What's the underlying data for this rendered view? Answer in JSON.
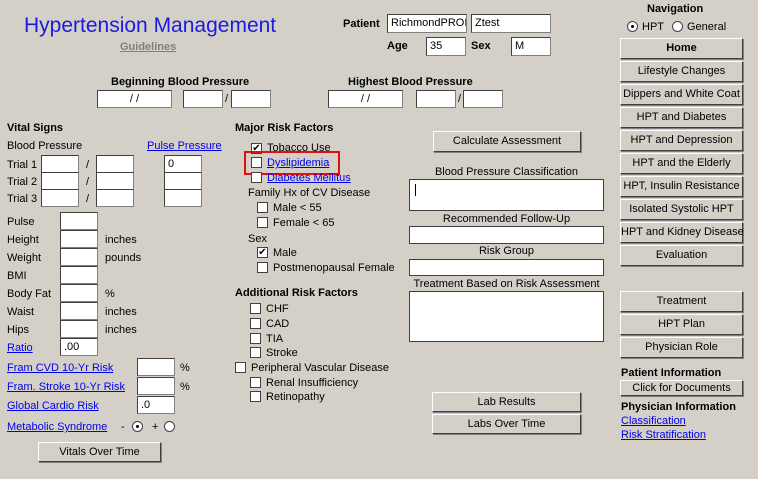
{
  "app": {
    "title": "Hypertension Management",
    "guidelines_link": "Guidelines"
  },
  "patient": {
    "label": "Patient",
    "first_name": "RichmondPROI",
    "last_name": "Ztest",
    "age_label": "Age",
    "age": "35",
    "sex_label": "Sex",
    "sex": "M"
  },
  "bp": {
    "beginning_label": "Beginning Blood Pressure",
    "beginning_date": "/ /",
    "highest_label": "Highest Blood Pressure",
    "highest_date": "/ /",
    "slash": "/"
  },
  "vitals": {
    "heading": "Vital Signs",
    "bp_label": "Blood Pressure",
    "pulse_pressure_link": "Pulse Pressure",
    "trials": [
      "Trial 1",
      "Trial 2",
      "Trial 3"
    ],
    "pulse_pressure_value": "0",
    "pulse": "Pulse",
    "height": "Height",
    "weight": "Weight",
    "bmi": "BMI",
    "body_fat": "Body Fat",
    "waist": "Waist",
    "hips": "Hips",
    "inches": "inches",
    "pounds": "pounds",
    "percent": "%",
    "ratio_link": "Ratio",
    "ratio_value": ".00",
    "fram_cvd_link": "Fram CVD 10-Yr Risk",
    "fram_stroke_link": "Fram. Stroke 10-Yr Risk",
    "global_cardio_link": "Global Cardio Risk",
    "global_cardio_value": ".0",
    "metabolic_link": "Metabolic Syndrome",
    "minus": "-",
    "plus": "+",
    "vitals_over_time": "Vitals Over Time"
  },
  "risk": {
    "heading": "Major Risk Factors",
    "tobacco": "Tobacco Use",
    "dyslipidemia": "Dyslipidemia",
    "diabetes": "Diabetes Mellitus",
    "family_hx": "Family Hx of CV Disease",
    "male_55": "Male < 55",
    "female_65": "Female < 65",
    "sex_label": "Sex",
    "male": "Male",
    "postmenopausal": "Postmenopausal Female",
    "additional_heading": "Additional Risk Factors",
    "chf": "CHF",
    "cad": "CAD",
    "tia": "TIA",
    "stroke": "Stroke",
    "pvd": "Peripheral Vascular Disease",
    "renal": "Renal Insufficiency",
    "retinopathy": "Retinopathy"
  },
  "assessment": {
    "calculate": "Calculate Assessment",
    "classification": "Blood Pressure Classification",
    "follow_up": "Recommended Follow-Up",
    "risk_group": "Risk Group",
    "treatment": "Treatment Based on Risk Assessment",
    "lab_results": "Lab Results",
    "labs_over_time": "Labs Over Time"
  },
  "navigation": {
    "heading": "Navigation",
    "hpt": "HPT",
    "general": "General",
    "items": [
      "Home",
      "Lifestyle Changes",
      "Dippers and White Coat",
      "HPT and Diabetes",
      "HPT and Depression",
      "HPT and the Elderly",
      "HPT,  Insulin Resistance",
      "Isolated Systolic HPT",
      "HPT and Kidney Disease",
      "Evaluation"
    ],
    "items2": [
      "Treatment",
      "HPT Plan",
      "Physician Role"
    ],
    "patient_info_heading": "Patient Information",
    "click_docs": "Click for Documents",
    "physician_info_heading": "Physician Information",
    "classification_link": "Classification",
    "risk_strat_link": "Risk Stratification"
  },
  "colors": {
    "title_blue": "#1a1ae0",
    "link_blue": "#0000ee",
    "highlight_red": "#e01010",
    "background": "#d4d0c8"
  }
}
